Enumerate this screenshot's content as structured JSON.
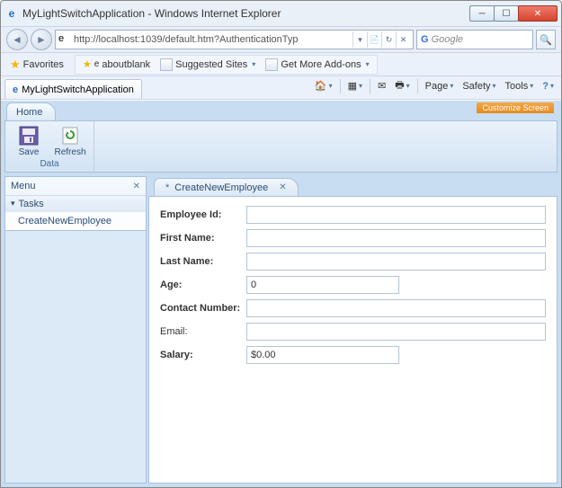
{
  "window": {
    "title": "MyLightSwitchApplication - Windows Internet Explorer"
  },
  "nav": {
    "url": "http://localhost:1039/default.htm?AuthenticationTyp",
    "search_placeholder": "Google"
  },
  "favbar": {
    "favorites": "Favorites",
    "aboutblank": "aboutblank",
    "suggested": "Suggested Sites",
    "addons": "Get More Add-ons"
  },
  "ietab": {
    "label": "MyLightSwitchApplication"
  },
  "cmdbar": {
    "page": "Page",
    "safety": "Safety",
    "tools": "Tools"
  },
  "app": {
    "home_tab": "Home",
    "customize": "Customize Screen",
    "ribbon": {
      "save": "Save",
      "refresh": "Refresh",
      "group": "Data"
    },
    "menu": {
      "header": "Menu",
      "tasks_header": "Tasks",
      "items": [
        "CreateNewEmployee"
      ]
    },
    "form": {
      "tab_title": "CreateNewEmployee",
      "fields": {
        "employee_id": {
          "label": "Employee Id:",
          "value": "",
          "bold": true
        },
        "first_name": {
          "label": "First Name:",
          "value": "",
          "bold": true
        },
        "last_name": {
          "label": "Last Name:",
          "value": "",
          "bold": true
        },
        "age": {
          "label": "Age:",
          "value": "0",
          "bold": true
        },
        "contact": {
          "label": "Contact Number:",
          "value": "",
          "bold": true
        },
        "email": {
          "label": "Email:",
          "value": "",
          "bold": false
        },
        "salary": {
          "label": "Salary:",
          "value": "$0.00",
          "bold": true
        }
      }
    }
  }
}
